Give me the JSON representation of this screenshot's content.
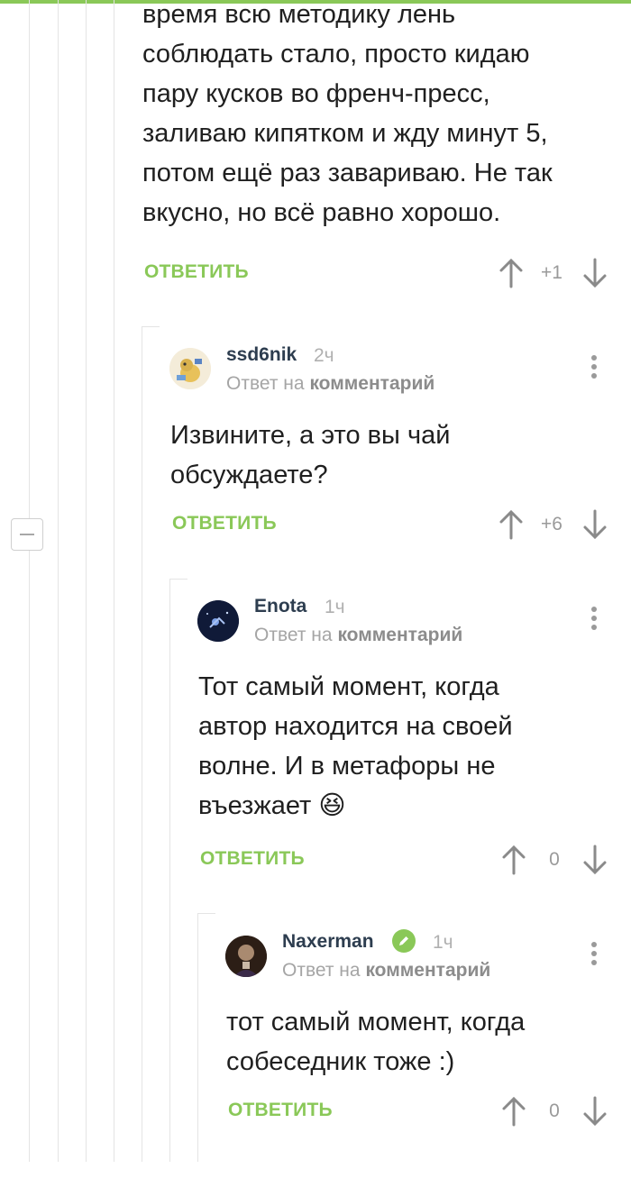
{
  "comments": [
    {
      "text_lines": [
        "время всю методику лень",
        "соблюдать стало, просто кидаю",
        "пару кусков во френч-пресс,",
        "заливаю кипятком и жду минут 5,",
        "потом ещё раз завариваю. Не так",
        "вкусно, но всё равно хорошо."
      ],
      "reply_label": "ОТВЕТИТЬ",
      "score": "+1"
    },
    {
      "author": "ssd6nik",
      "time": "2ч",
      "reply_to_prefix": "Ответ на",
      "reply_to_target": "комментарий",
      "text_lines": [
        "Извините, а это вы чай",
        "обсуждаете?"
      ],
      "reply_label": "ОТВЕТИТЬ",
      "score": "+6"
    },
    {
      "author": "Enota",
      "time": "1ч",
      "reply_to_prefix": "Ответ на",
      "reply_to_target": "комментарий",
      "text_lines": [
        "Тот самый момент, когда",
        "автор находится на своей",
        "волне. И в метафоры не",
        "въезжает"
      ],
      "emoji": "😆",
      "reply_label": "ОТВЕТИТЬ",
      "score": "0"
    },
    {
      "author": "Naxerman",
      "verified": true,
      "time": "1ч",
      "reply_to_prefix": "Ответ на",
      "reply_to_target": "комментарий",
      "text_lines": [
        "тот самый момент, когда",
        "собеседник тоже :)"
      ],
      "reply_label": "ОТВЕТИТЬ",
      "score": "0"
    }
  ],
  "colors": {
    "accent": "#8ac858",
    "author": "#2d3d4f",
    "muted": "#a5a5a5",
    "thread_line": "#e4e4e4"
  }
}
